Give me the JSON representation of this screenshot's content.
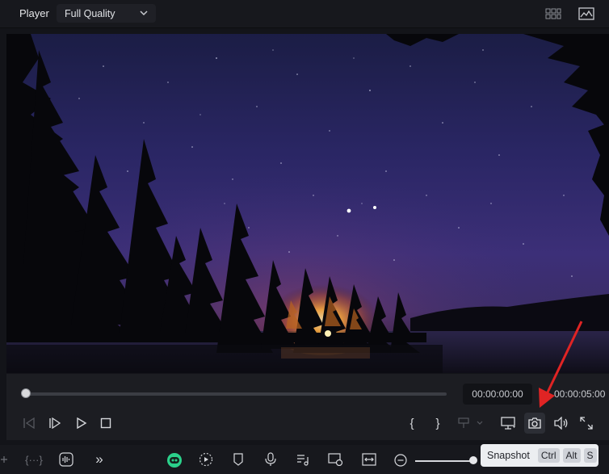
{
  "header": {
    "title": "Player",
    "quality": "Full Quality"
  },
  "time": {
    "current": "00:00:00:00",
    "total": "00:00:05:00"
  },
  "tooltip": {
    "label": "Snapshot",
    "keys": [
      "Ctrl",
      "Alt",
      "S"
    ]
  },
  "playback": {
    "progress": 0.0
  },
  "colors": {
    "accent": "#e02424",
    "tooltip_bg": "#eceef1"
  }
}
